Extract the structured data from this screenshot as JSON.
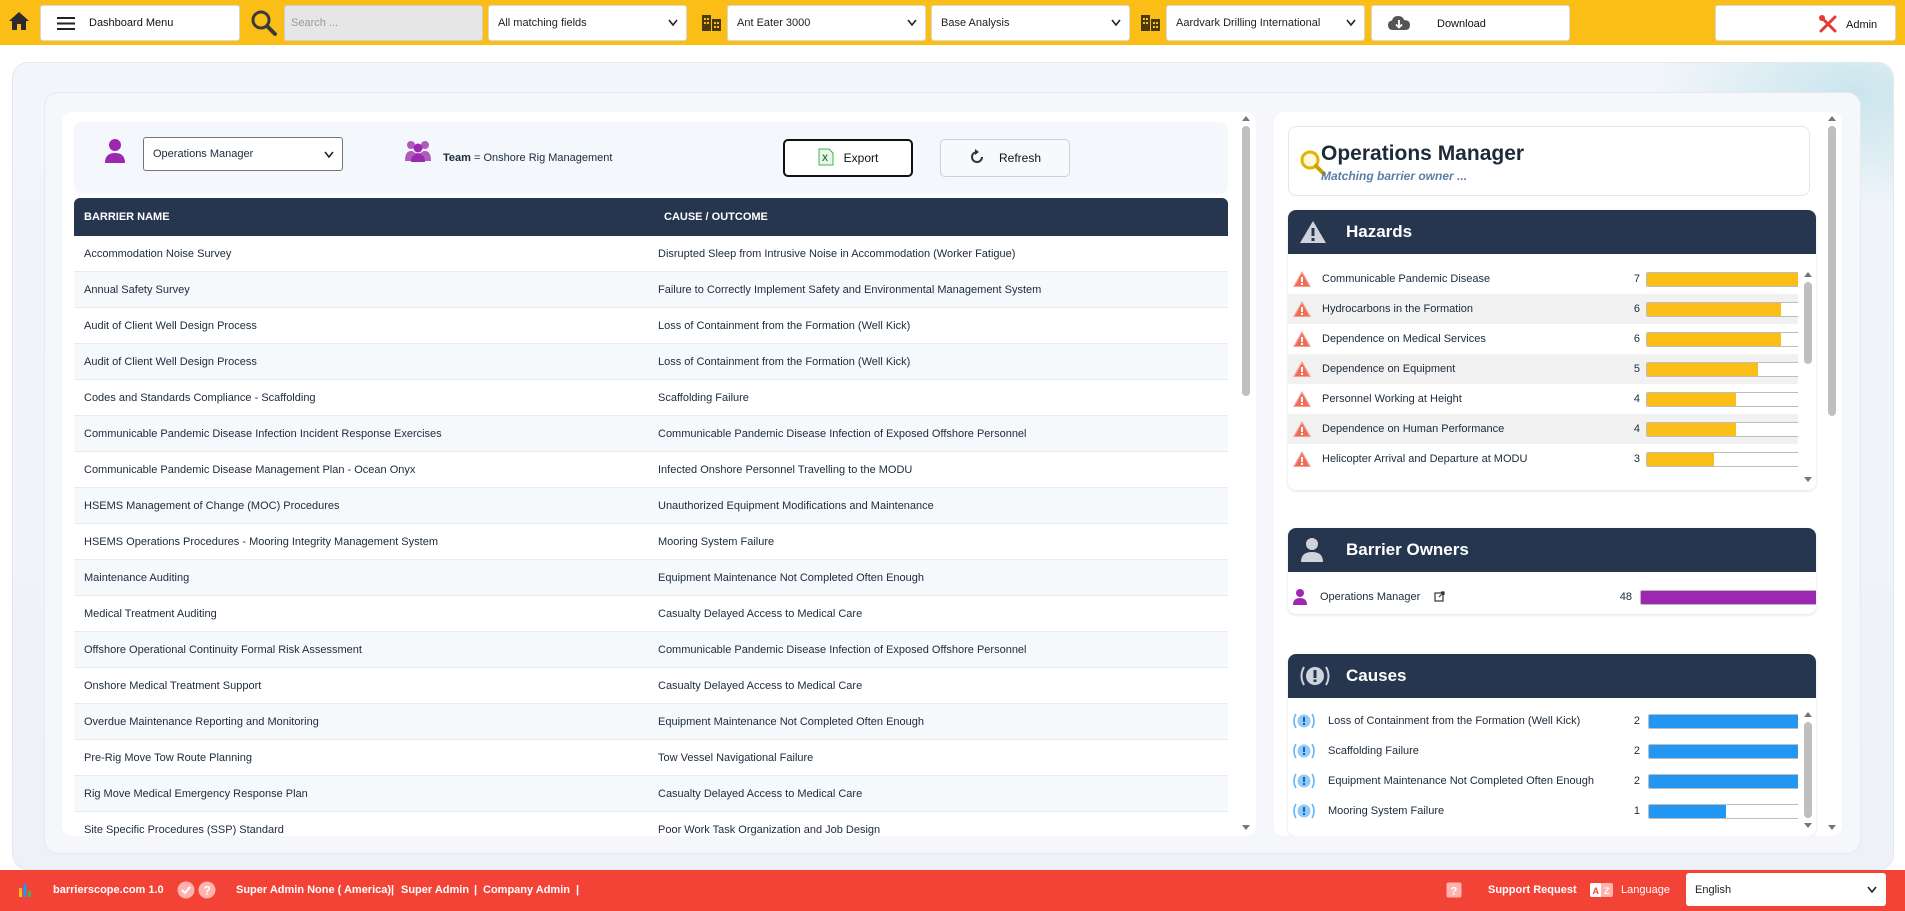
{
  "topbar": {
    "menu_label": "Dashboard Menu",
    "search_placeholder": "Search ...",
    "field_filter": "All matching fields",
    "installation": "Ant Eater 3000",
    "analysis": "Base Analysis",
    "company": "Aardvark Drilling International",
    "download_label": "Download",
    "user_label": "Admin"
  },
  "owner_bar": {
    "owner_select": "Operations Manager",
    "team_label": "Team",
    "team_value": "= Onshore Rig Management",
    "export_label": "Export",
    "refresh_label": "Refresh"
  },
  "table": {
    "headers": [
      "Barrier Name",
      "Cause / Outcome"
    ],
    "rows": [
      [
        "Accommodation Noise Survey",
        "Disrupted Sleep from Intrusive Noise in Accommodation (Worker Fatigue)"
      ],
      [
        "Annual Safety Survey",
        "Failure to Correctly Implement Safety and Environmental Management System"
      ],
      [
        "Audit of Client Well Design Process",
        "Loss of Containment from the Formation (Well Kick)"
      ],
      [
        "Audit of Client Well Design Process",
        "Loss of Containment from the Formation (Well Kick)"
      ],
      [
        "Codes and Standards Compliance - Scaffolding",
        "Scaffolding Failure"
      ],
      [
        "Communicable Pandemic Disease Infection Incident Response Exercises",
        "Communicable Pandemic Disease Infection of Exposed Offshore Personnel"
      ],
      [
        "Communicable Pandemic Disease Management Plan - Ocean Onyx",
        "Infected Onshore Personnel Travelling to the MODU"
      ],
      [
        "HSEMS Management of Change (MOC) Procedures",
        "Unauthorized Equipment Modifications and Maintenance"
      ],
      [
        "HSEMS Operations Procedures - Mooring Integrity Management System",
        "Mooring System Failure"
      ],
      [
        "Maintenance Auditing",
        "Equipment Maintenance Not Completed Often Enough"
      ],
      [
        "Medical Treatment Auditing",
        "Casualty Delayed Access to Medical Care"
      ],
      [
        "Offshore Operational Continuity Formal Risk Assessment",
        "Communicable Pandemic Disease Infection of Exposed Offshore Personnel"
      ],
      [
        "Onshore Medical Treatment Support",
        "Casualty Delayed Access to Medical Care"
      ],
      [
        "Overdue Maintenance Reporting and Monitoring",
        "Equipment Maintenance Not Completed Often Enough"
      ],
      [
        "Pre-Rig Move Tow Route Planning",
        "Tow Vessel Navigational Failure"
      ],
      [
        "Rig Move Medical Emergency Response Plan",
        "Casualty Delayed Access to Medical Care"
      ],
      [
        "Site Specific Procedures (SSP) Standard",
        "Poor Work Task Organization and Job Design"
      ]
    ]
  },
  "right": {
    "title": "Operations Manager",
    "subtitle": "Matching barrier owner ...",
    "hazards": {
      "title": "Hazards",
      "max": 7,
      "color": "#fbbe16",
      "items": [
        {
          "label": "Communicable Pandemic Disease",
          "count": 7
        },
        {
          "label": "Hydrocarbons in the Formation",
          "count": 6
        },
        {
          "label": "Dependence on Medical Services",
          "count": 6
        },
        {
          "label": "Dependence on Equipment",
          "count": 5
        },
        {
          "label": "Personnel Working at Height",
          "count": 4
        },
        {
          "label": "Dependence on Human Performance",
          "count": 4
        },
        {
          "label": "Helicopter Arrival and Departure at MODU",
          "count": 3
        }
      ]
    },
    "owners": {
      "title": "Barrier Owners",
      "max": 48,
      "color": "#9c27b0",
      "items": [
        {
          "label": "Operations Manager",
          "count": 48
        }
      ]
    },
    "causes": {
      "title": "Causes",
      "max": 2,
      "color": "#2196f3",
      "items": [
        {
          "label": "Loss of Containment from the Formation (Well Kick)",
          "count": 2
        },
        {
          "label": "Scaffolding Failure",
          "count": 2
        },
        {
          "label": "Equipment Maintenance Not Completed Often Enough",
          "count": 2
        },
        {
          "label": "Mooring System Failure",
          "count": 1
        }
      ]
    }
  },
  "footer": {
    "brand": "barrierscope.com 1.0",
    "user_info": "Super Admin None ( America)",
    "role1": "Super Admin",
    "role2": "Company Admin",
    "sep": "|",
    "support": "Support Request",
    "language_label": "Language",
    "language_value": "English"
  }
}
